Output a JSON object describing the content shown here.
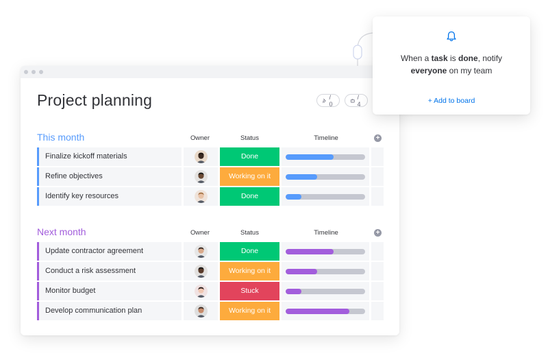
{
  "board": {
    "title": "Project planning",
    "pins_count": "/ 0",
    "people_count": "/ 4",
    "columns": {
      "owner": "Owner",
      "status": "Status",
      "timeline": "Timeline"
    },
    "groups": [
      {
        "title": "This month",
        "color": "#579bfc",
        "items": [
          {
            "name": "Finalize kickoff materials",
            "status": "Done",
            "status_color": "#00c875",
            "timeline_fraction": 0.6,
            "timeline_color": "#579bfc",
            "avatar": "avatar-1"
          },
          {
            "name": "Refine objectives",
            "status": "Working on it",
            "status_color": "#fdab3d",
            "timeline_fraction": 0.4,
            "timeline_color": "#579bfc",
            "avatar": "avatar-2"
          },
          {
            "name": "Identify key resources",
            "status": "Done",
            "status_color": "#00c875",
            "timeline_fraction": 0.2,
            "timeline_color": "#579bfc",
            "avatar": "avatar-3"
          }
        ]
      },
      {
        "title": "Next month",
        "color": "#a25ddc",
        "items": [
          {
            "name": "Update contractor agreement",
            "status": "Done",
            "status_color": "#00c875",
            "timeline_fraction": 0.6,
            "timeline_color": "#a25ddc",
            "avatar": "avatar-4"
          },
          {
            "name": "Conduct a risk assessment",
            "status": "Working on it",
            "status_color": "#fdab3d",
            "timeline_fraction": 0.4,
            "timeline_color": "#a25ddc",
            "avatar": "avatar-5"
          },
          {
            "name": "Monitor budget",
            "status": "Stuck",
            "status_color": "#e2445c",
            "timeline_fraction": 0.2,
            "timeline_color": "#a25ddc",
            "avatar": "avatar-6"
          },
          {
            "name": "Develop communication plan",
            "status": "Working on it",
            "status_color": "#fdab3d",
            "timeline_fraction": 0.8,
            "timeline_color": "#a25ddc",
            "avatar": "avatar-7"
          }
        ]
      }
    ]
  },
  "notification": {
    "icon": "bell-icon",
    "text_1": "When a ",
    "text_task": "task",
    "text_2": " is ",
    "text_done": "done",
    "text_3": ", notify",
    "text_everyone": "everyone",
    "text_4": " on my team",
    "add_to_board": "+ Add to board"
  }
}
